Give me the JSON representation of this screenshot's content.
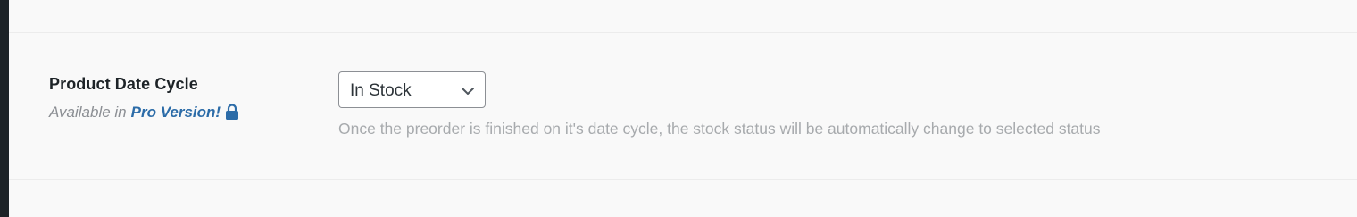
{
  "setting": {
    "title": "Product Date Cycle",
    "availability_prefix": "Available in",
    "pro_link": "Pro Version!",
    "lock_icon": "lock-icon",
    "select": {
      "selected": "In Stock",
      "icon": "chevron-down-icon"
    },
    "description": "Once the preorder is finished on it's date cycle, the stock status will be automatically change to selected status"
  },
  "colors": {
    "background": "#f9f9f9",
    "sidebar_edge": "#1d2327",
    "pro_link": "#2c6ca8",
    "muted_text": "#a7aaad"
  }
}
